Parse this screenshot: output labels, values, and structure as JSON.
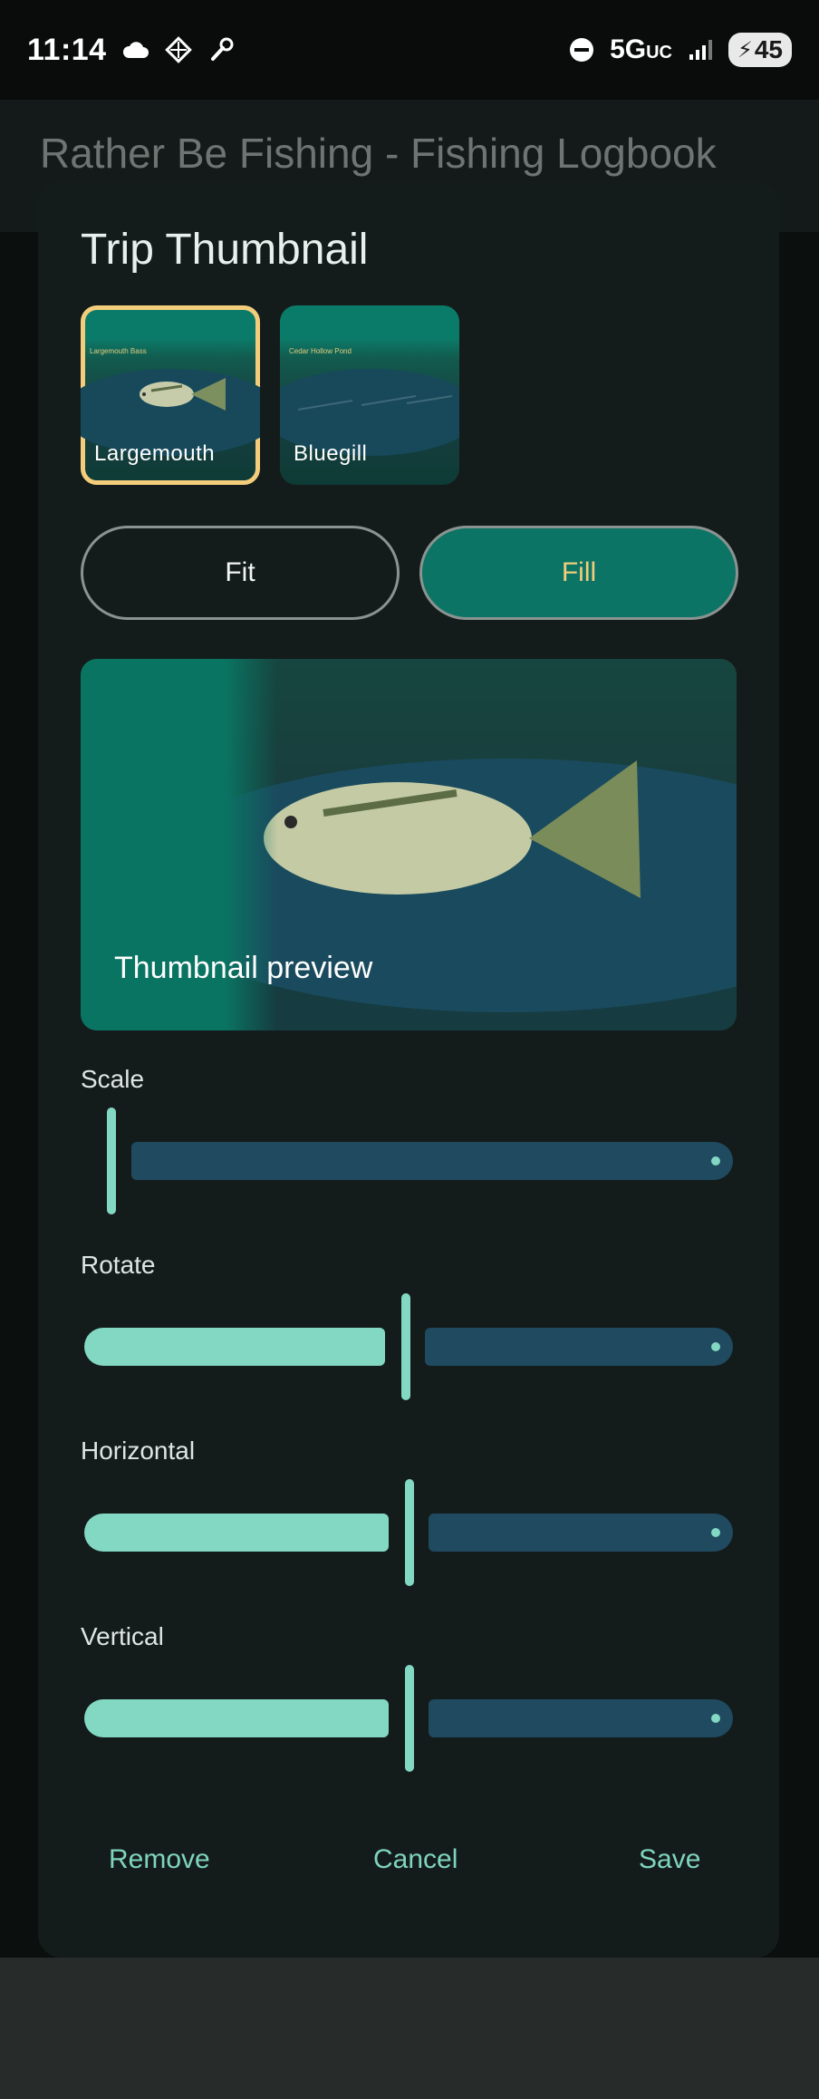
{
  "status_bar": {
    "time": "11:14",
    "network": "5G",
    "network_suffix": "UC",
    "battery": "45",
    "icons": [
      "cloud-icon",
      "diamond-grid-icon",
      "wrench-icon",
      "do-not-disturb-icon",
      "signal-icon",
      "charging-bolt-icon"
    ]
  },
  "app": {
    "title": "Rather Be Fishing - Fishing Logbook"
  },
  "dialog": {
    "title": "Trip Thumbnail",
    "thumbnails": [
      {
        "caption": "Largemouth",
        "small_label": "Largemouth Bass",
        "selected": true
      },
      {
        "caption": "Bluegill",
        "small_label": "Cedar Hollow Pond",
        "selected": false
      }
    ],
    "scale_modes": [
      {
        "label": "Fit",
        "active": false
      },
      {
        "label": "Fill",
        "active": true
      }
    ],
    "preview_label": "Thumbnail preview",
    "sliders": [
      {
        "label": "Scale",
        "value_fraction": 0.0
      },
      {
        "label": "Rotate",
        "value_fraction": 0.5
      },
      {
        "label": "Horizontal",
        "value_fraction": 0.5
      },
      {
        "label": "Vertical",
        "value_fraction": 0.5
      }
    ],
    "actions": {
      "remove": "Remove",
      "cancel": "Cancel",
      "save": "Save"
    }
  },
  "colors": {
    "accent": "#82d8c2",
    "selected_outline": "#f3cd7c",
    "fill_button": "#0b7464",
    "inactive_track": "#1f4a60"
  }
}
